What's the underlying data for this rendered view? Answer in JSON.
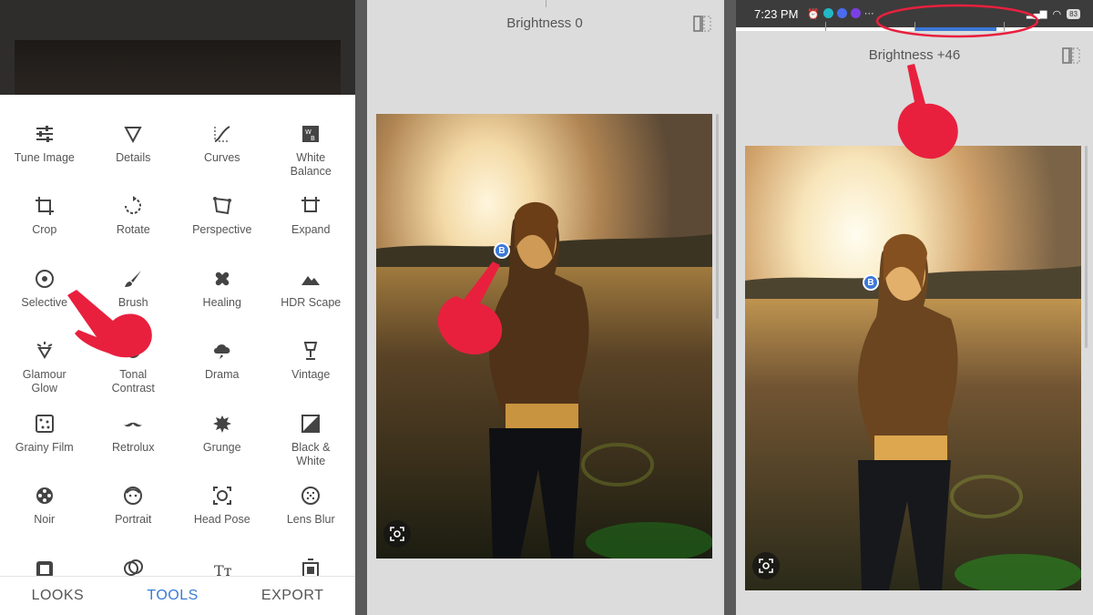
{
  "panel_tools": {
    "tools": [
      {
        "label": "Tune Image",
        "icon": "tune-sliders-icon"
      },
      {
        "label": "Details",
        "icon": "triangle-details-icon"
      },
      {
        "label": "Curves",
        "icon": "curves-icon"
      },
      {
        "label": "White\nBalance",
        "icon": "white-balance-icon"
      },
      {
        "label": "Crop",
        "icon": "crop-icon"
      },
      {
        "label": "Rotate",
        "icon": "rotate-icon"
      },
      {
        "label": "Perspective",
        "icon": "perspective-icon"
      },
      {
        "label": "Expand",
        "icon": "expand-icon"
      },
      {
        "label": "Selective",
        "icon": "selective-icon"
      },
      {
        "label": "Brush",
        "icon": "brush-icon"
      },
      {
        "label": "Healing",
        "icon": "healing-icon"
      },
      {
        "label": "HDR Scape",
        "icon": "hdr-mountain-icon"
      },
      {
        "label": "Glamour\nGlow",
        "icon": "glamour-glow-icon"
      },
      {
        "label": "Tonal\nContrast",
        "icon": "tonal-contrast-icon"
      },
      {
        "label": "Drama",
        "icon": "drama-cloud-icon"
      },
      {
        "label": "Vintage",
        "icon": "vintage-lamp-icon"
      },
      {
        "label": "Grainy Film",
        "icon": "grainy-film-icon"
      },
      {
        "label": "Retrolux",
        "icon": "mustache-icon"
      },
      {
        "label": "Grunge",
        "icon": "grunge-icon"
      },
      {
        "label": "Black &\nWhite",
        "icon": "black-white-icon"
      },
      {
        "label": "Noir",
        "icon": "film-reel-icon"
      },
      {
        "label": "Portrait",
        "icon": "portrait-face-icon"
      },
      {
        "label": "Head Pose",
        "icon": "head-pose-icon"
      },
      {
        "label": "Lens Blur",
        "icon": "lens-blur-icon"
      },
      {
        "label": "",
        "icon": "frames-icon"
      },
      {
        "label": "",
        "icon": "double-exposure-icon"
      },
      {
        "label": "",
        "icon": "text-icon"
      },
      {
        "label": "",
        "icon": "expand-frame-icon"
      }
    ],
    "tabs": {
      "looks": "LOOKS",
      "tools": "TOOLS",
      "export": "EXPORT",
      "active": "TOOLS"
    }
  },
  "panel_brightness_zero": {
    "label": "Brightness 0",
    "marker": "B"
  },
  "panel_brightness_plus": {
    "status_time": "7:23 PM",
    "battery": "83",
    "label": "Brightness +46",
    "marker": "B",
    "slider_value": 46
  },
  "colors": {
    "accent": "#3c78d8",
    "annotation_red": "#e8203e"
  }
}
